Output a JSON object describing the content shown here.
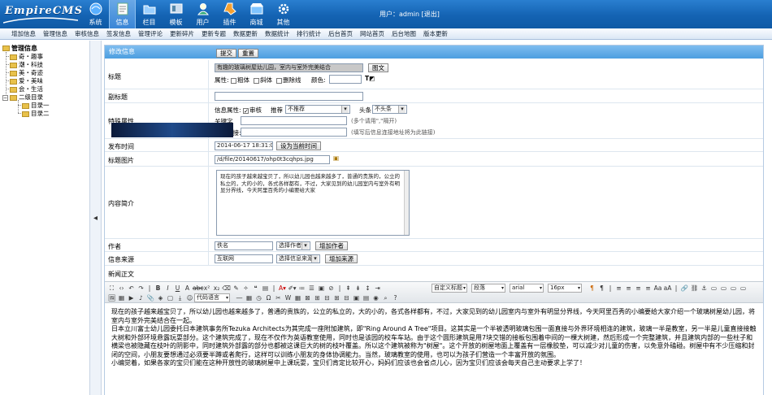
{
  "logo": {
    "text": "EmpireCMS"
  },
  "nav": [
    {
      "label": "系统",
      "icon": "system-icon"
    },
    {
      "label": "信息",
      "icon": "info-icon",
      "active": true
    },
    {
      "label": "栏目",
      "icon": "column-icon"
    },
    {
      "label": "模板",
      "icon": "template-icon"
    },
    {
      "label": "用户",
      "icon": "user-icon"
    },
    {
      "label": "插件",
      "icon": "plugin-icon"
    },
    {
      "label": "商城",
      "icon": "shop-icon"
    },
    {
      "label": "其他",
      "icon": "other-icon"
    }
  ],
  "user": {
    "text": "用户：admin [退出]"
  },
  "menu": [
    "增加信息",
    "管理信息",
    "审核信息",
    "签发信息",
    "管理评论",
    "更新碎片",
    "更新专题",
    "数据更新",
    "数据统计",
    "排行统计",
    "后台首页",
    "网站首页",
    "后台地图",
    "版本更新"
  ],
  "tree": {
    "root": "管理信息",
    "items": [
      "奇・趣事",
      "潮・科技",
      "美・奇迹",
      "爱・美味",
      "会・生活",
      "二级目录"
    ],
    "sub": [
      "目录一",
      "目录二"
    ]
  },
  "form": {
    "header": "修改信息",
    "submit": "提交",
    "reset": "重置",
    "title_label": "标题",
    "title_value": "有趣的玻璃树屋幼儿园，室内与室外完美结合",
    "title_img_btn": "图文",
    "attr_label": "属性:",
    "attr_bold": "粗体",
    "attr_italic": "斜体",
    "attr_strike": "删除线",
    "attr_color": "颜色:",
    "subtitle_label": "副标题",
    "special_label": "特殊属性",
    "info_attr": "信息属性:",
    "audit": "审核",
    "recommend": "推荐",
    "recommend_value": "不推荐",
    "headline": "头条",
    "headline_value": "不头条",
    "keyword_label": "关键字",
    "keyword_note": "(多个请用\",\"隔开)",
    "link_label": "外部链接:",
    "link_note": "(填写后信息连接地址将为此链接)",
    "time_label": "发布时间",
    "time_value": "2014-06-17 18:31:04",
    "time_btn": "设为当前时间",
    "pic_label": "标题图片",
    "pic_value": "/d/file/20140617/ohp0t3cqhps.jpg",
    "summary_label": "内容简介",
    "summary_value": "现在的孩子越来越宝贝了，所以幼儿园也越来越多了，普通的贵族的，公立的私立的，大的小的，各式各样都有，不过，大家见到的幼儿园室内与室外有明显分界线，今天阿里百秀的小编要给大家",
    "author_label": "作者",
    "author_value": "佚名",
    "author_select": "选择作者",
    "author_add": "增加作者",
    "source_label": "信息来源",
    "source_value": "互联网",
    "source_select": "选择信息来源",
    "source_add": "增加来源",
    "body_label": "新闻正文"
  },
  "editor": {
    "format": "自定义标题",
    "para": "段落",
    "font": "arial",
    "size": "16px",
    "code": "代码语言",
    "paragraphs": [
      "现在的孩子越来越宝贝了，所以幼儿园也越来越多了，普通的贵族的，公立的私立的，大的小的，各式各样都有，不过，大家见到的幼儿园室内与室外有明显分界线，今天阿里百秀的小编要给大家介绍一个玻璃树屋幼儿园，将室内与室外完美结合在一起。",
      "日本立川富士幼儿园委托日本建筑事务所Tezuka Architects为其完成一座附加建筑，即\"Ring Around A Tree\"项目。这其实是一个半被透明玻璃包围一面直接与外界环境相连的建筑，玻璃一半是教室，另一半是儿童直接接触大树和外部环境悬露玩耍部分。这个建筑完成了，现在不仅作为英语教室使用，同时也是该园的校车车站。由于这个圆形建筑是用7块交错的接板包围着中间的一棵大树建，然后形成一个完整建筑，并且建筑内部的一些柱子和横梁也被隐藏在枝叶的阴影中，同时建筑外部露的部分也都被这课巨大的树的枝叶覆盖。所以这个建筑被称为\"树屋\"。这个开放的树屋地面上覆盖有一层橡胶垫，可以减少对儿童的伤害，以免意外磕碰。树屋中有不少压缩和封闭的空间，小朋友要想通过必须要半蹲或者爬行，这样可以训练小朋友的身体协调能力。当然，玻璃教室的使用，也可以为孩子们营造一个丰富开放的氛围。",
      "小编觉着，如果各家的宝贝们能在这种开放性的玻璃树屋中上课玩耍，宝贝们肯定比较开心，妈妈们应该也会省点儿心，因为宝贝们应该会每天自己主动要求上学了！"
    ]
  },
  "colors": {
    "header_blue": "#1463b3",
    "panel_blue": "#4c9ee0"
  }
}
